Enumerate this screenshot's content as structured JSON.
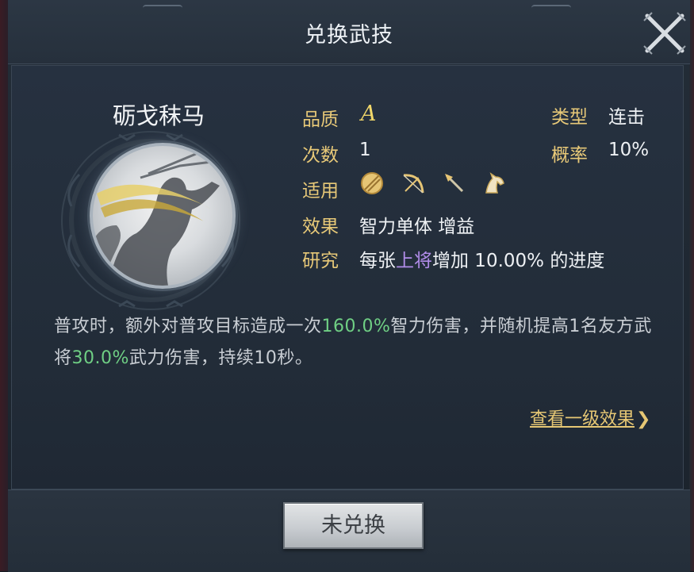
{
  "dialog": {
    "title": "兑换武技",
    "close_icon": "crossed-swords-close-icon"
  },
  "skill": {
    "name": "砺戈秣马",
    "quality_label": "品质",
    "quality_value": "A",
    "type_label": "类型",
    "type_value": "连击",
    "count_label": "次数",
    "count_value": "1",
    "chance_label": "概率",
    "chance_value": "10%",
    "applicable_label": "适用",
    "applicable_icons": [
      "shield-icon",
      "bow-icon",
      "spear-icon",
      "horse-icon"
    ],
    "effect_label": "效果",
    "effect_value": "智力单体 增益",
    "research_label": "研究",
    "research_prefix": "每张",
    "research_highlight": "上将",
    "research_suffix": "增加 10.00% 的进度"
  },
  "description": {
    "part1": "普攻时，额外对普攻目标造成一次",
    "hl1": "160.0%",
    "part2": "智力伤害，并随机提高1名友方武将",
    "hl2": "30.0%",
    "part3": "武力伤害，持续10秒。"
  },
  "links": {
    "view_level1": "查看一级效果",
    "view_level1_arrow": "❯"
  },
  "footer": {
    "button_label": "未兑换"
  },
  "colors": {
    "label_gold": "#e8c978",
    "highlight_green": "#6fcf84",
    "highlight_purple": "#b08ce8",
    "quality_yellow": "#f1d76a"
  }
}
